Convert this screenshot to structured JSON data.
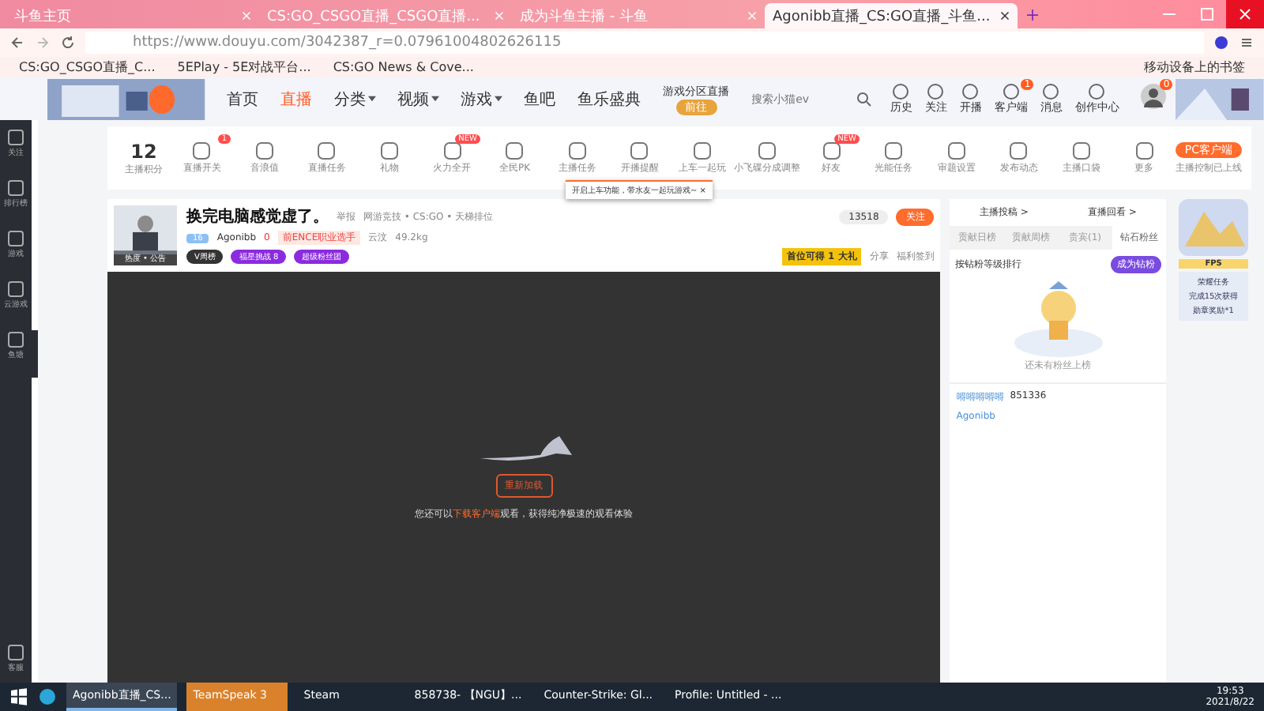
{
  "browser": {
    "tabs": [
      {
        "title": "斗鱼主页",
        "selected": false
      },
      {
        "title": "CS:GO_CSGO直播_CSGO直播...",
        "selected": false
      },
      {
        "title": "成为斗鱼主播 - 斗鱼",
        "selected": false
      },
      {
        "title": "Agonibb直播_CS:GO直播_斗鱼...",
        "selected": true
      }
    ],
    "url": "https://www.douyu.com/3042387_r=0.07961004802626115",
    "bookmarks": [
      "CS:GO_CSGO直播_C...",
      "5EPlay - 5E对战平台...",
      "CS:GO News & Cove..."
    ],
    "mobile_bookmarks": "移动设备上的书签"
  },
  "site_header": {
    "nav": [
      {
        "label": "首页",
        "selected": false,
        "dropdown": false
      },
      {
        "label": "直播",
        "selected": true,
        "dropdown": false
      },
      {
        "label": "分类",
        "selected": false,
        "dropdown": true
      },
      {
        "label": "视频",
        "selected": false,
        "dropdown": true
      },
      {
        "label": "游戏",
        "selected": false,
        "dropdown": true
      },
      {
        "label": "鱼吧",
        "selected": false,
        "dropdown": false
      },
      {
        "label": "鱼乐盛典",
        "selected": false,
        "dropdown": false
      }
    ],
    "promo": {
      "title": "游戏分区直播",
      "button": "前往"
    },
    "search": {
      "placeholder": "搜索小猫ev"
    },
    "actions": [
      {
        "label": "历史"
      },
      {
        "label": "关注"
      },
      {
        "label": "开播"
      },
      {
        "label": "客户端",
        "badge": "1"
      },
      {
        "label": "消息"
      },
      {
        "label": "创作中心"
      }
    ],
    "avatar_badge": "0"
  },
  "sidebar": {
    "items": [
      "关注",
      "排行榜",
      "游戏",
      "云游戏",
      "鱼塘"
    ],
    "bottom": "客服"
  },
  "toolbar": {
    "score": {
      "value": "12",
      "label": "主播积分"
    },
    "items": [
      {
        "label": "直播开关",
        "badge": "1"
      },
      {
        "label": "音浪值"
      },
      {
        "label": "直播任务"
      },
      {
        "label": "礼物"
      },
      {
        "label": "火力全开",
        "badge": "NEW"
      },
      {
        "label": "全民PK"
      },
      {
        "label": "主播任务"
      },
      {
        "label": "开播提醒"
      },
      {
        "label": "上车一起玩"
      },
      {
        "label": "小飞碟分成调整"
      },
      {
        "label": "好友",
        "badge": "NEW"
      },
      {
        "label": "光能任务"
      },
      {
        "label": "审题设置"
      },
      {
        "label": "发布动态"
      },
      {
        "label": "主播口袋"
      },
      {
        "label": "更多"
      }
    ],
    "client_button": "PC客户端",
    "client_note": "主播控制已上线",
    "tooltip": {
      "text": "开启上车功能，带水友一起玩游戏~",
      "close": "×"
    }
  },
  "room": {
    "title": "换完电脑感觉虚了。",
    "report": "举报",
    "category": "网游竞技 • CS:GO • 天梯排位",
    "level": "16",
    "name": "Agonibb",
    "hot": "0",
    "tag": "前ENCE职业选手",
    "location": "云汶",
    "weight": "49.2kg",
    "avatar_caption": "热度 • 公告",
    "chips": [
      "V周榜",
      "福星挑战 8",
      "超级粉丝团"
    ],
    "follow_count": "13518",
    "follow": "关注",
    "promo": "首位可得 1 大礼",
    "share": "分享",
    "sign": "福利签到"
  },
  "player": {
    "reload": "重新加载",
    "message": {
      "before": "您还可以",
      "link": "下载客户端",
      "after": "观看，获得纯净极速的观看体验"
    }
  },
  "right_panel": {
    "links": [
      "主播投稿 >",
      "直播回看 >"
    ],
    "tabs": [
      {
        "label": "贡献日榜",
        "selected": false
      },
      {
        "label": "贡献周榜",
        "selected": false
      },
      {
        "label": "贵宾(1)",
        "selected": false
      },
      {
        "label": "钻石粉丝",
        "selected": true
      }
    ],
    "rank_note": "按钻粉等级排行",
    "become": "成为钻粉",
    "empty": "还未有粉丝上榜",
    "chat": [
      {
        "name": "嘚嘚嘚嘚嘚",
        "text": "851336"
      },
      {
        "name": "Agonibb"
      }
    ]
  },
  "ads": {
    "label": "FPS",
    "task": "荣耀任务",
    "desc": "完成15次获得",
    "reward": "勋章奖励*1"
  },
  "taskbar": {
    "tasks": [
      {
        "title": "Agonibb直播_CS...",
        "selected": true,
        "flashing": false
      },
      {
        "title": "TeamSpeak 3",
        "selected": false,
        "flashing": true
      },
      {
        "title": "Steam",
        "selected": false,
        "flashing": false
      },
      {
        "title": "858738- 【NGU】...",
        "selected": false,
        "flashing": false
      },
      {
        "title": "Counter-Strike: Gl...",
        "selected": false,
        "flashing": false
      },
      {
        "title": "Profile: Untitled - ...",
        "selected": false,
        "flashing": false
      }
    ],
    "time": "19:53",
    "date": "2021/8/22"
  }
}
